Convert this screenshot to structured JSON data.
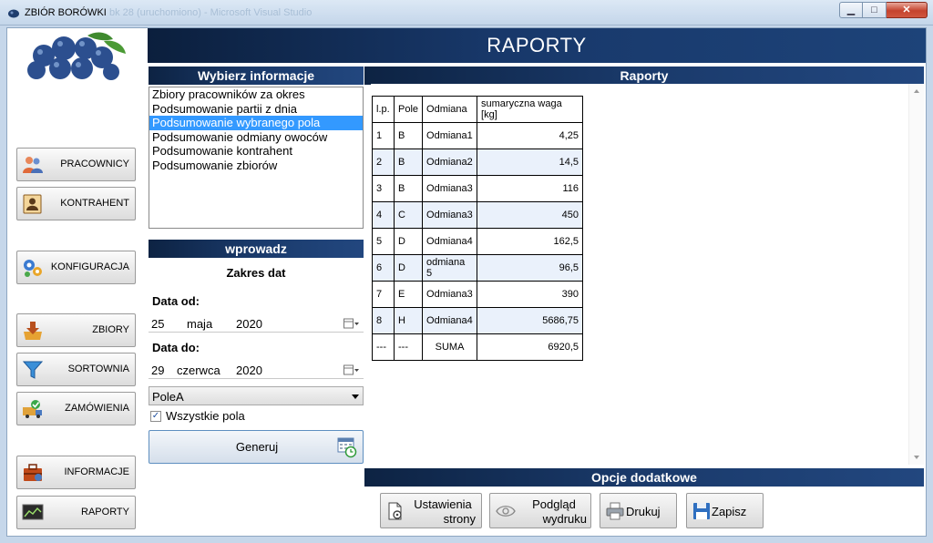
{
  "window": {
    "title": "ZBIÓR BORÓWKI",
    "ghost_title": "bk 28 (uruchomiono) - Microsoft Visual Studio",
    "min_glyph": "▁",
    "max_glyph": "□",
    "close_glyph": "✕"
  },
  "header": {
    "title": "RAPORTY"
  },
  "sidebar": {
    "items": [
      {
        "label": "PRACOWNICY",
        "icon": "users-icon"
      },
      {
        "label": "KONTRAHENT",
        "icon": "contact-card-icon"
      },
      {
        "label": "KONFIGURACJA",
        "icon": "gears-icon"
      },
      {
        "label": "ZBIORY",
        "icon": "download-tray-icon"
      },
      {
        "label": "SORTOWNIA",
        "icon": "funnel-icon"
      },
      {
        "label": "ZAMÓWIENIA",
        "icon": "truck-check-icon"
      },
      {
        "label": "INFORMACJE",
        "icon": "briefcase-icon"
      },
      {
        "label": "RAPORTY",
        "icon": "chart-monitor-icon"
      }
    ]
  },
  "info_panel": {
    "title": "Wybierz informacje",
    "items": [
      "Zbiory pracowników za okres",
      "Podsumowanie partii z dnia",
      "Podsumowanie wybranego pola",
      "Podsumowanie odmiany owoców",
      "Podsumowanie kontrahent",
      "Podsumowanie zbiorów"
    ],
    "selected_index": 2
  },
  "input_panel": {
    "title": "wprowadz",
    "range_label": "Zakres dat",
    "from_label": "Data od:",
    "from_day": "25",
    "from_month": "maja",
    "from_year": "2020",
    "to_label": "Data do:",
    "to_day": "29",
    "to_month": "czerwca",
    "to_year": "2020",
    "field_value": "PoleA",
    "all_fields_label": "Wszystkie pola",
    "all_fields_checked": true,
    "check_glyph": "✓",
    "generate_label": "Generuj"
  },
  "report": {
    "title": "Raporty",
    "columns": [
      "l.p.",
      "Pole",
      "Odmiana",
      "sumaryczna waga [kg]"
    ],
    "rows": [
      [
        "1",
        "B",
        "Odmiana1",
        "4,25"
      ],
      [
        "2",
        "B",
        "Odmiana2",
        "14,5"
      ],
      [
        "3",
        "B",
        "Odmiana3",
        "116"
      ],
      [
        "4",
        "C",
        "Odmiana3",
        "450"
      ],
      [
        "5",
        "D",
        "Odmiana4",
        "162,5"
      ],
      [
        "6",
        "D",
        "odmiana 5",
        "96,5"
      ],
      [
        "7",
        "E",
        "Odmiana3",
        "390"
      ],
      [
        "8",
        "H",
        "Odmiana4",
        "5686,75"
      ],
      [
        "---",
        "---",
        "SUMA",
        "6920,5"
      ]
    ]
  },
  "options": {
    "title": "Opcje dodatkowe",
    "page_setup_line1": "Ustawienia",
    "page_setup_line2": "strony",
    "preview_line1": "Podgląd",
    "preview_line2": "wydruku",
    "print_label": "Drukuj",
    "save_label": "Zapisz"
  }
}
